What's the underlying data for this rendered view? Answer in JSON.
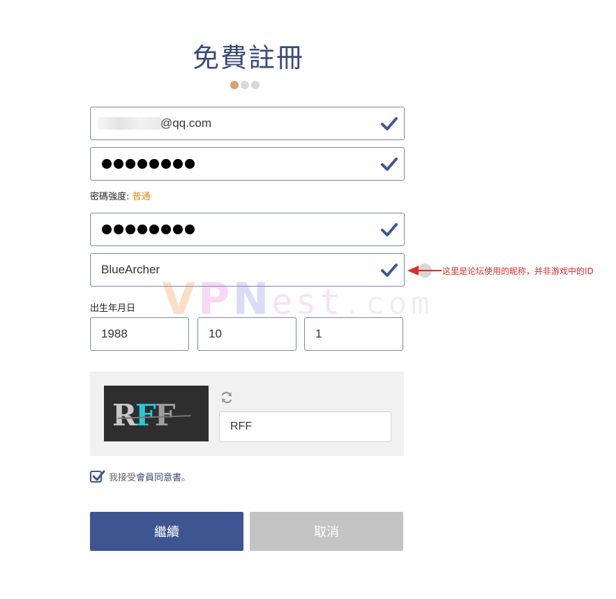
{
  "page": {
    "title": "免費註冊",
    "steps_total": 3,
    "steps_active": 1
  },
  "form": {
    "email": {
      "value_suffix": "@qq.com",
      "valid": true
    },
    "password": {
      "masked_length": 8,
      "valid": true
    },
    "password_strength_label": "密碼強度:",
    "password_strength_value": "普通",
    "confirm_password": {
      "masked_length": 8,
      "valid": true
    },
    "nickname": {
      "value": "BlueArcher",
      "valid": true
    },
    "birthday_label": "出生年月日",
    "birth_year": "1988",
    "birth_month": "10",
    "birth_day": "1"
  },
  "captcha": {
    "image_text_chars": [
      "R",
      "F",
      "F"
    ],
    "input_value": "RFF"
  },
  "agreement": {
    "checked": true,
    "prefix": "我接受",
    "link": "會員同意書",
    "suffix": "。"
  },
  "buttons": {
    "continue": "繼續",
    "cancel": "取消"
  },
  "annotation": {
    "text": "这里是论坛使用的昵称，并非游戏中的ID"
  },
  "watermark": {
    "parts": [
      "V",
      "P",
      "N",
      "est",
      ".com"
    ]
  },
  "colors": {
    "primary": "#3e5591",
    "title": "#3b4a78",
    "field_border": "#7a86b3",
    "strength": "#d98a1c",
    "step_active": "#d9a46b",
    "cancel_bg": "#c4c4c4",
    "annotation": "#e02b2b"
  },
  "icons": {
    "valid": "check-icon",
    "refresh": "refresh-icon",
    "annotation": "arrow-left-icon"
  }
}
